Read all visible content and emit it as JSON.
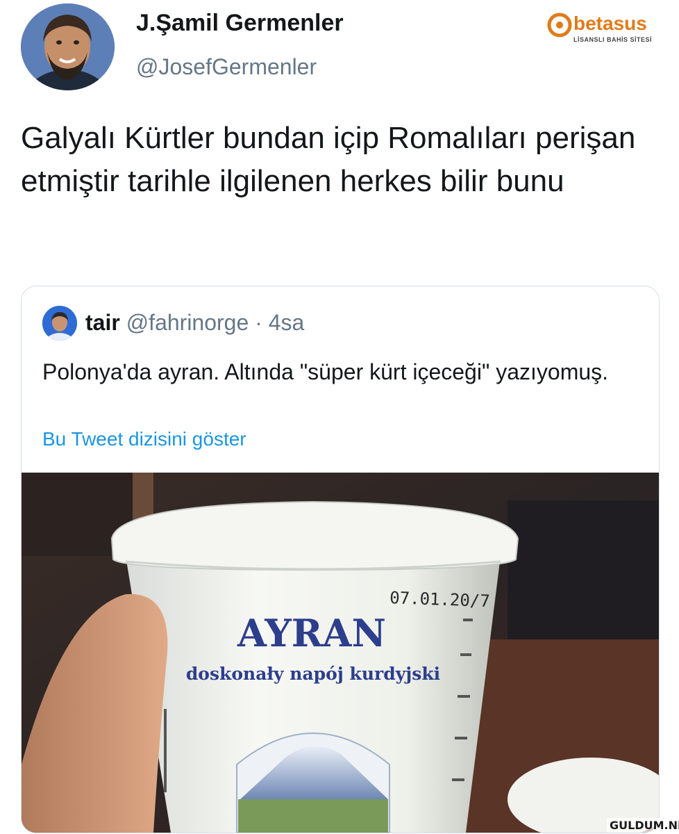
{
  "tweet": {
    "author_name": "J.Şamil Germenler",
    "author_handle": "@JosefGermenler",
    "text": "Galyalı Kürtler bundan içip Romalıları perişan etmiştir tarihle ilgilenen herkes bilir bunu"
  },
  "quoted_tweet": {
    "author_name": "tair",
    "author_handle": "@fahrinorge",
    "separator": "·",
    "time": "4sa",
    "text": "Polonya'da ayran. Altında \"süper kürt içeceği\" yazıyomuş.",
    "thread_link": "Bu Tweet dizisini göster",
    "photo": {
      "label_brand": "AYRAN",
      "label_tagline": "doskonały napój kurdyjski",
      "label_date": "07.01.20/7"
    }
  },
  "watermark": {
    "brand": "betasus",
    "subtitle": "LİSANSLI BAHİS SİTESİ",
    "site": "GULDUM.NET"
  }
}
